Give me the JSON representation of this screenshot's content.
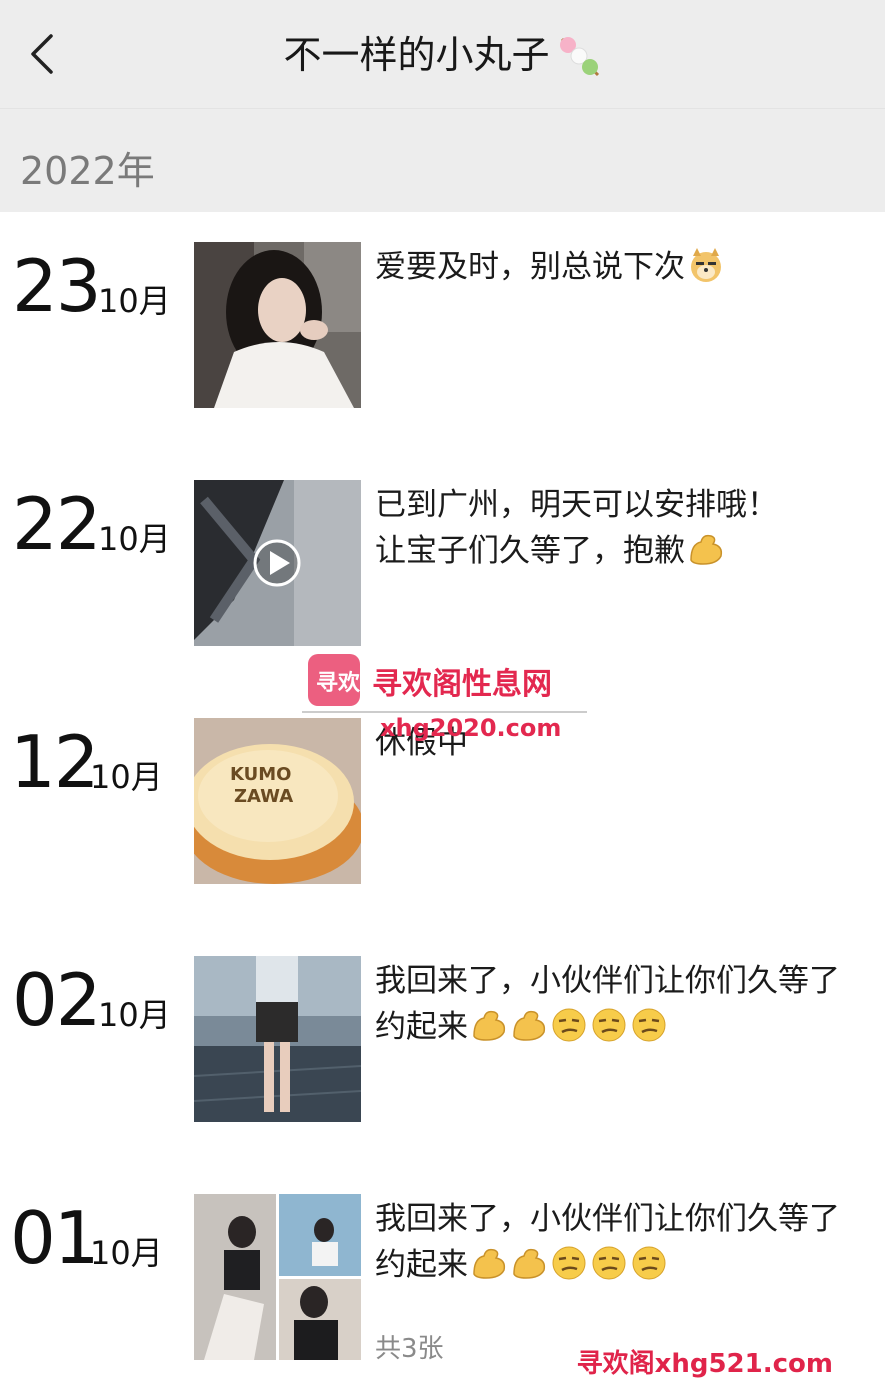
{
  "header": {
    "title": "不一样的小丸子",
    "title_icon": "dango-icon",
    "back_icon": "chevron-left-icon"
  },
  "year_label": "2022年",
  "posts": [
    {
      "day": "23",
      "month": "10月",
      "text": "爱要及时，别总说下次",
      "emojis": [
        "doge-icon"
      ],
      "media": "photo",
      "count": ""
    },
    {
      "day": "22",
      "month": "10月",
      "text": "已到广州，明天可以安排哦！\n让宝子们久等了，抱歉",
      "emojis": [
        "muscle-icon"
      ],
      "media": "video",
      "count": ""
    },
    {
      "day": "12",
      "month": "10月",
      "text": "休假中",
      "emojis": [],
      "media": "photo",
      "count": ""
    },
    {
      "day": "02",
      "month": "10月",
      "text": "我回来了，小伙伴们让你们久等了\n约起来",
      "emojis": [
        "muscle-icon",
        "muscle-icon",
        "smirk-icon",
        "smirk-icon",
        "smirk-icon"
      ],
      "media": "photo",
      "count": ""
    },
    {
      "day": "01",
      "month": "10月",
      "text": "我回来了，小伙伴们让你们久等了\n约起来",
      "emojis": [
        "muscle-icon",
        "muscle-icon",
        "smirk-icon",
        "smirk-icon",
        "smirk-icon"
      ],
      "media": "collage",
      "count": "共3张"
    }
  ],
  "watermark": {
    "center_title": "寻欢阁性息网",
    "center_url": "xhg2020.com",
    "logo_text": "寻欢",
    "bottom": "寻欢阁xhg521.com"
  },
  "colors": {
    "header_bg": "#ededed",
    "watermark_red": "#e0244a"
  }
}
